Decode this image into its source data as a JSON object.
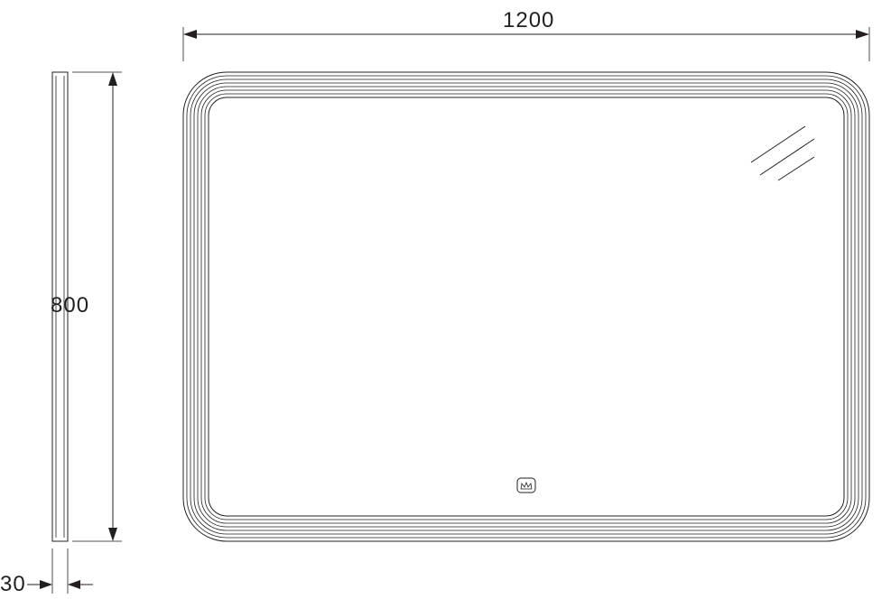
{
  "dimensions": {
    "width_label": "1200",
    "height_label": "800",
    "depth_label": "30"
  },
  "unit_system": "mm",
  "product": {
    "type": "rounded-rectangle-mirror",
    "has_touch_button": true
  }
}
